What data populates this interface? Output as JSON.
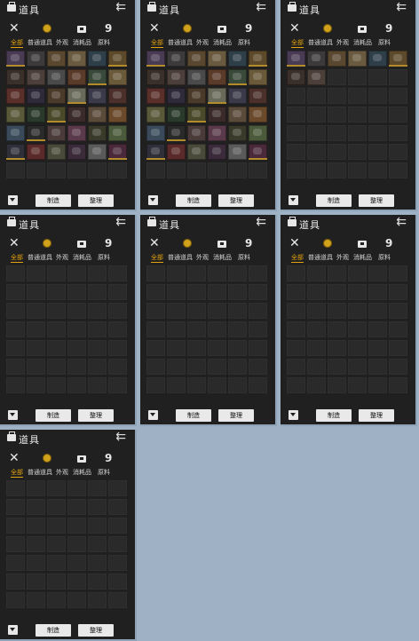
{
  "panel": {
    "title": "道具",
    "back_glyph": "⇇",
    "close_glyph": "✕",
    "gourd_glyph": "9",
    "tabs": [
      "全部",
      "普通道具",
      "外观",
      "消耗品",
      "原料"
    ],
    "buttons": {
      "make": "制造",
      "sort": "整理"
    },
    "icons": [
      "bag-icon",
      "back-arrow-icon",
      "close-icon",
      "gold-bag-icon",
      "chest-icon",
      "gourd-icon",
      "filter-icon"
    ]
  },
  "panels": [
    {
      "name": "panel-1",
      "active_tab": 0,
      "items": 36
    },
    {
      "name": "panel-2",
      "active_tab": 0,
      "items": 36
    },
    {
      "name": "panel-3",
      "active_tab": 0,
      "items": 8
    },
    {
      "name": "panel-4",
      "active_tab": 0,
      "items": 0
    },
    {
      "name": "panel-5",
      "active_tab": 0,
      "items": 0
    },
    {
      "name": "panel-6",
      "active_tab": 0,
      "items": 0
    },
    {
      "name": "panel-7",
      "active_tab": 0,
      "items": 0
    }
  ],
  "palette": {
    "accent": "#e2a10e",
    "panel_bg": "#202020",
    "cell_bg": "#2a2a2a",
    "background": "#9fb1c5"
  }
}
